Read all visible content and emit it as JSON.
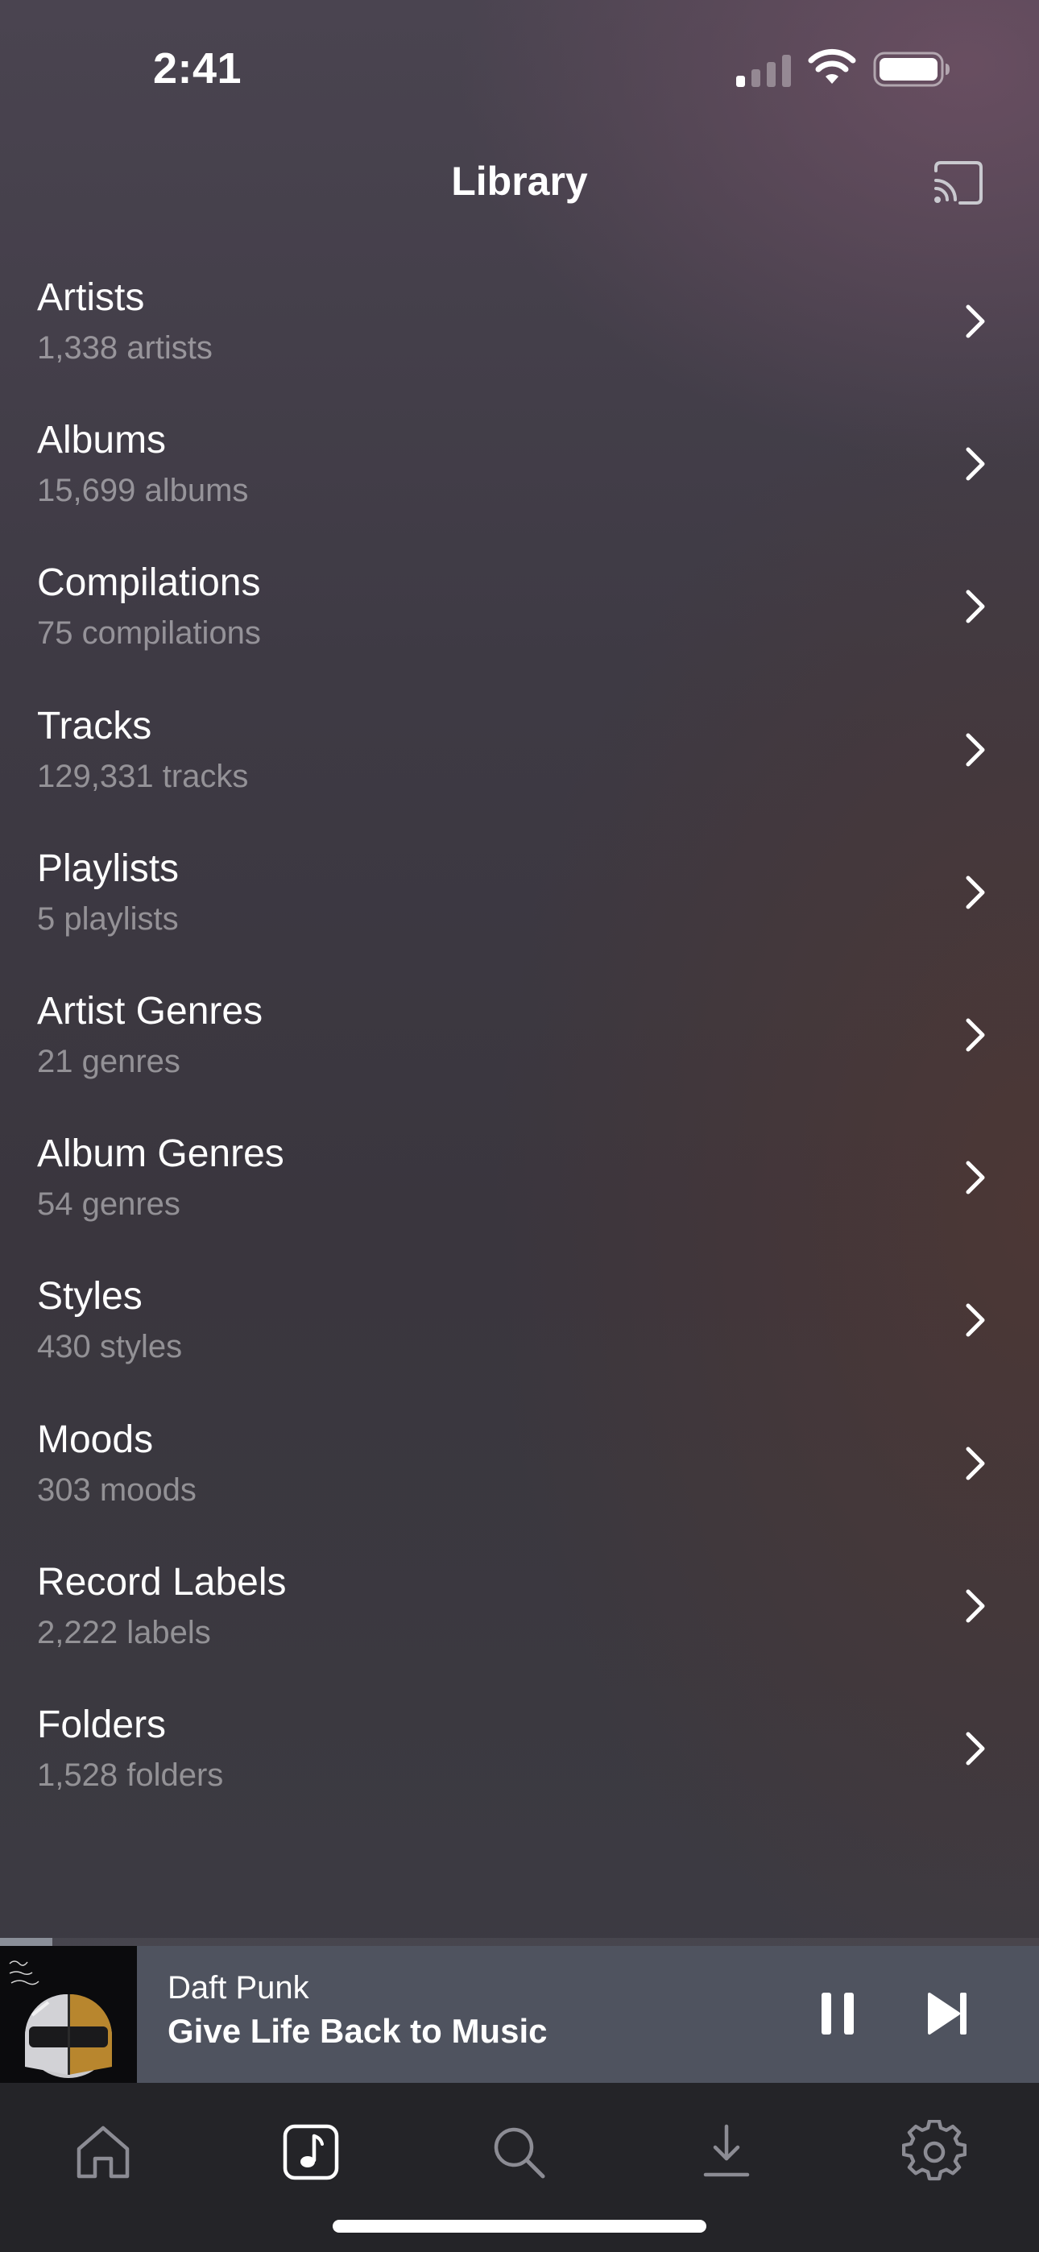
{
  "status_bar": {
    "time": "2:41",
    "signal_icon": "cellular-signal-icon",
    "wifi_icon": "wifi-icon",
    "battery_icon": "battery-icon"
  },
  "nav": {
    "title": "Library",
    "cast_icon": "cast-icon"
  },
  "library": {
    "items": [
      {
        "title": "Artists",
        "subtitle": "1,338 artists"
      },
      {
        "title": "Albums",
        "subtitle": "15,699 albums"
      },
      {
        "title": "Compilations",
        "subtitle": "75 compilations"
      },
      {
        "title": "Tracks",
        "subtitle": "129,331 tracks"
      },
      {
        "title": "Playlists",
        "subtitle": "5 playlists"
      },
      {
        "title": "Artist Genres",
        "subtitle": "21 genres"
      },
      {
        "title": "Album Genres",
        "subtitle": "54 genres"
      },
      {
        "title": "Styles",
        "subtitle": "430 styles"
      },
      {
        "title": "Moods",
        "subtitle": "303 moods"
      },
      {
        "title": "Record Labels",
        "subtitle": "2,222 labels"
      },
      {
        "title": "Folders",
        "subtitle": "1,528 folders"
      }
    ]
  },
  "now_playing": {
    "artist": "Daft Punk",
    "title": "Give Life Back to Music",
    "progress": 0.05,
    "state": "playing"
  },
  "tab_bar": {
    "tabs": [
      {
        "icon": "home-icon",
        "active": false
      },
      {
        "icon": "music-note-icon",
        "active": true
      },
      {
        "icon": "search-icon",
        "active": false
      },
      {
        "icon": "download-icon",
        "active": false
      },
      {
        "icon": "gear-icon",
        "active": false
      }
    ]
  },
  "colors": {
    "mini_player_bg": "#4f535f",
    "tab_bar_bg": "#242428",
    "inactive_icon": "#8c8c94",
    "active_icon": "#ffffff"
  }
}
